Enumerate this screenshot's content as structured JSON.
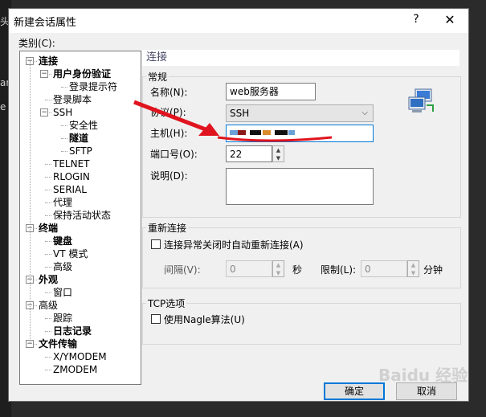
{
  "background": {
    "side_glyphs": [
      "头",
      "an",
      "e"
    ]
  },
  "dialog": {
    "title": "新建会话属性",
    "help_label": "?",
    "close_label": "✕",
    "category_label": "类别(C):",
    "tree": [
      {
        "label": "连接",
        "bold": true,
        "toggle": "−"
      },
      {
        "label": "用户身份验证",
        "bold": true,
        "toggle": "−"
      },
      {
        "label": "登录提示符",
        "bold": false
      },
      {
        "label": "登录脚本",
        "bold": false
      },
      {
        "label": "SSH",
        "bold": false,
        "toggle": "−"
      },
      {
        "label": "安全性",
        "bold": false
      },
      {
        "label": "隧道",
        "bold": true
      },
      {
        "label": "SFTP",
        "bold": false
      },
      {
        "label": "TELNET",
        "bold": false
      },
      {
        "label": "RLOGIN",
        "bold": false
      },
      {
        "label": "SERIAL",
        "bold": false
      },
      {
        "label": "代理",
        "bold": false
      },
      {
        "label": "保持活动状态",
        "bold": false
      },
      {
        "label": "终端",
        "bold": true,
        "toggle": "−"
      },
      {
        "label": "键盘",
        "bold": true
      },
      {
        "label": "VT 模式",
        "bold": false
      },
      {
        "label": "高级",
        "bold": false
      },
      {
        "label": "外观",
        "bold": true,
        "toggle": "−"
      },
      {
        "label": "窗口",
        "bold": false
      },
      {
        "label": "高级",
        "bold": false,
        "toggle": "−"
      },
      {
        "label": "跟踪",
        "bold": false
      },
      {
        "label": "日志记录",
        "bold": true
      },
      {
        "label": "文件传输",
        "bold": true,
        "toggle": "−"
      },
      {
        "label": "X/YMODEM",
        "bold": false
      },
      {
        "label": "ZMODEM",
        "bold": false
      }
    ],
    "section_title": "连接",
    "general": {
      "legend": "常规",
      "name_label": "名称(N):",
      "name_value": "web服务器",
      "protocol_label": "协议(P):",
      "protocol_value": "SSH",
      "host_label": "主机(H):",
      "host_value": "",
      "port_label": "端口号(O):",
      "port_value": "22",
      "desc_label": "说明(D):",
      "desc_value": ""
    },
    "reconnect": {
      "legend": "重新连接",
      "checkbox_label": "连接异常关闭时自动重新连接(A)",
      "interval_label": "间隔(V):",
      "interval_value": "0",
      "interval_unit": "秒",
      "limit_label": "限制(L):",
      "limit_value": "0",
      "limit_unit": "分钟"
    },
    "tcp": {
      "legend": "TCP选项",
      "nagle_label": "使用Nagle算法(U)"
    },
    "buttons": {
      "ok": "确定",
      "cancel": "取消"
    },
    "watermark": "Baidu 经验",
    "colors": {
      "arrow": "#e0141e",
      "focus": "#0078d7"
    }
  }
}
